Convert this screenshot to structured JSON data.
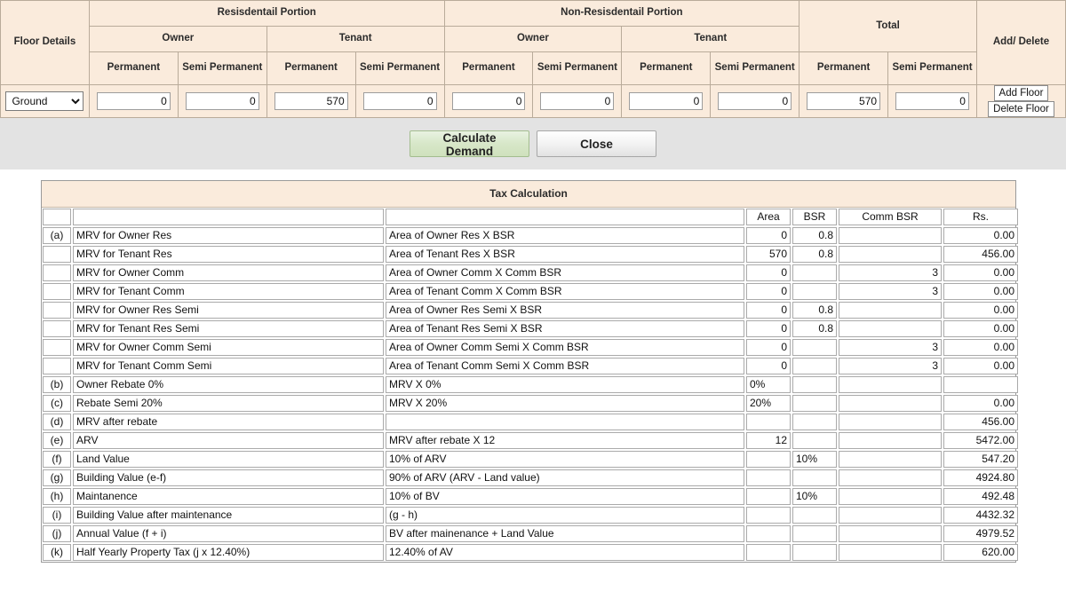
{
  "floor_section": {
    "headers": {
      "floor_details": "Floor Details",
      "residential_portion": "Resisdentail Portion",
      "non_residential_portion": "Non-Resisdentail Portion",
      "total": "Total",
      "add_delete": "Add/ Delete",
      "owner": "Owner",
      "tenant": "Tenant",
      "permanent": "Permanent",
      "semi_permanent": "Semi Permanent"
    },
    "row": {
      "floor_value": "Ground",
      "floor_options": [
        "Ground"
      ],
      "res_owner_permanent": "0",
      "res_owner_semi": "0",
      "res_tenant_permanent": "570",
      "res_tenant_semi": "0",
      "nonres_owner_permanent": "0",
      "nonres_owner_semi": "0",
      "nonres_tenant_permanent": "0",
      "nonres_tenant_semi": "0",
      "total_permanent": "570",
      "total_semi": "0",
      "add_floor_label": "Add Floor",
      "delete_floor_label": "Delete Floor"
    }
  },
  "action_bar": {
    "calculate_label": "Calculate Demand",
    "close_label": "Close"
  },
  "tax": {
    "title": "Tax Calculation",
    "columns": {
      "key": "",
      "description": "",
      "formula": "",
      "area": "Area",
      "bsr": "BSR",
      "comm_bsr": "Comm BSR",
      "rs": "Rs."
    },
    "rows": [
      {
        "key": "(a)",
        "desc": "MRV for Owner Res",
        "formula": "Area of Owner Res X BSR",
        "area": "0",
        "bsr": "0.8",
        "comm": "",
        "rs": "0.00"
      },
      {
        "key": "",
        "desc": "MRV for Tenant Res",
        "formula": "Area of Tenant Res X BSR",
        "area": "570",
        "bsr": "0.8",
        "comm": "",
        "rs": "456.00"
      },
      {
        "key": "",
        "desc": "MRV for Owner Comm",
        "formula": "Area of Owner Comm X Comm BSR",
        "area": "0",
        "bsr": "",
        "comm": "3",
        "rs": "0.00"
      },
      {
        "key": "",
        "desc": "MRV for Tenant Comm",
        "formula": "Area of Tenant Comm X Comm BSR",
        "area": "0",
        "bsr": "",
        "comm": "3",
        "rs": "0.00"
      },
      {
        "key": "",
        "desc": "MRV for Owner Res Semi",
        "formula": "Area of Owner Res Semi X BSR",
        "area": "0",
        "bsr": "0.8",
        "comm": "",
        "rs": "0.00"
      },
      {
        "key": "",
        "desc": "MRV for Tenant Res Semi",
        "formula": "Area of Tenant Res Semi X BSR",
        "area": "0",
        "bsr": "0.8",
        "comm": "",
        "rs": "0.00"
      },
      {
        "key": "",
        "desc": "MRV for Owner Comm Semi",
        "formula": "Area of Owner Comm Semi X Comm BSR",
        "area": "0",
        "bsr": "",
        "comm": "3",
        "rs": "0.00"
      },
      {
        "key": "",
        "desc": "MRV for Tenant Comm Semi",
        "formula": "Area of Tenant Comm Semi X Comm BSR",
        "area": "0",
        "bsr": "",
        "comm": "3",
        "rs": "0.00"
      },
      {
        "key": "(b)",
        "desc": "Owner Rebate 0%",
        "formula": "MRV X 0%",
        "area": "0%",
        "bsr": "",
        "comm": "",
        "rs": ""
      },
      {
        "key": "(c)",
        "desc": "Rebate Semi 20%",
        "formula": "MRV X 20%",
        "area": "20%",
        "bsr": "",
        "comm": "",
        "rs": "0.00"
      },
      {
        "key": "(d)",
        "desc": "MRV after rebate",
        "formula": "",
        "area": "",
        "bsr": "",
        "comm": "",
        "rs": "456.00"
      },
      {
        "key": "(e)",
        "desc": "ARV",
        "formula": "MRV after rebate X 12",
        "area": "12",
        "bsr": "",
        "comm": "",
        "rs": "5472.00"
      },
      {
        "key": "(f)",
        "desc": "Land Value",
        "formula": "10% of ARV",
        "area": "",
        "bsr": "10%",
        "comm": "",
        "rs": "547.20"
      },
      {
        "key": "(g)",
        "desc": "Building Value (e-f)",
        "formula": "90% of ARV (ARV - Land value)",
        "area": "",
        "bsr": "",
        "comm": "",
        "rs": "4924.80"
      },
      {
        "key": "(h)",
        "desc": "Maintanence",
        "formula": "10% of BV",
        "area": "",
        "bsr": "10%",
        "comm": "",
        "rs": "492.48"
      },
      {
        "key": "(i)",
        "desc": "Building Value after maintenance",
        "formula": "(g - h)",
        "area": "",
        "bsr": "",
        "comm": "",
        "rs": "4432.32"
      },
      {
        "key": "(j)",
        "desc": "Annual Value (f + i)",
        "formula": "BV after mainenance + Land Value",
        "area": "",
        "bsr": "",
        "comm": "",
        "rs": "4979.52"
      },
      {
        "key": "(k)",
        "desc": "Half Yearly Property Tax (j x 12.40%)",
        "formula": "12.40% of AV",
        "area": "",
        "bsr": "",
        "comm": "",
        "rs": "620.00"
      }
    ]
  },
  "colors": {
    "header_bg": "#FAEBDC",
    "action_bar_bg": "#E3E3E3",
    "primary_button": "#CFE1BD"
  }
}
